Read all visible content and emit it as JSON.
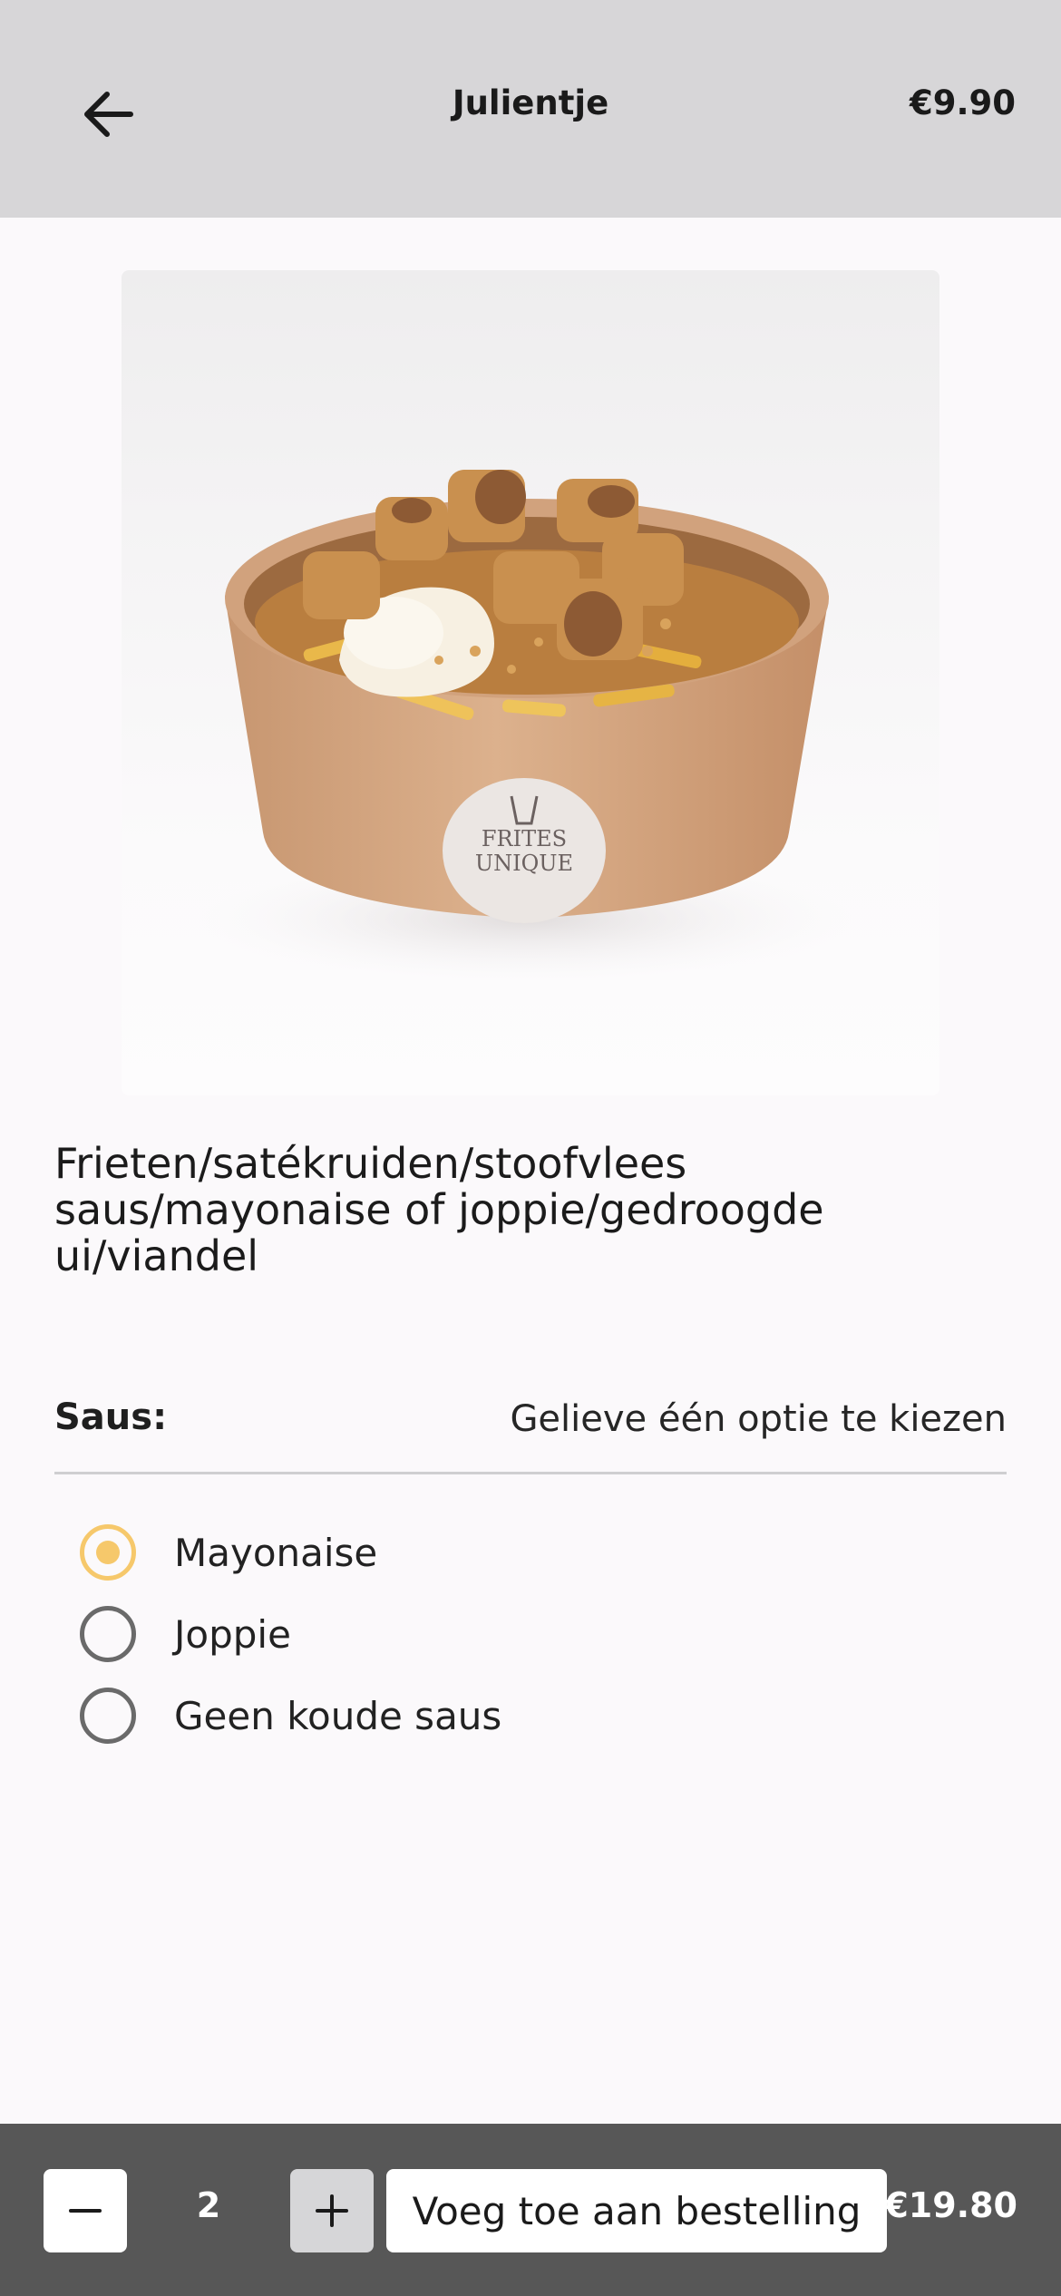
{
  "header": {
    "title": "Julientje",
    "price": "€9.90",
    "back_icon": "arrow-left-icon"
  },
  "product": {
    "image_alt": "Bowl of fries with toppings",
    "bowl_logo_line1": "FRITES",
    "bowl_logo_line2": "UNIQUE",
    "description": "Frieten/satékruiden/stoofvlees saus/mayonaise of joppie/gedroogde ui/viandel"
  },
  "options": {
    "label": "Saus:",
    "hint": "Gelieve één optie te kiezen",
    "items": [
      {
        "label": "Mayonaise",
        "selected": true
      },
      {
        "label": "Joppie",
        "selected": false
      },
      {
        "label": "Geen koude saus",
        "selected": false
      }
    ]
  },
  "footer": {
    "quantity": "2",
    "minus_icon": "minus-icon",
    "plus_icon": "plus-icon",
    "add_label": "Voeg toe aan bestelling",
    "total": "€19.80"
  },
  "colors": {
    "header_bg": "#d7d6d8",
    "footer_bg": "#575757",
    "accent": "#f6c86b",
    "page_bg": "#fbf9fb"
  }
}
